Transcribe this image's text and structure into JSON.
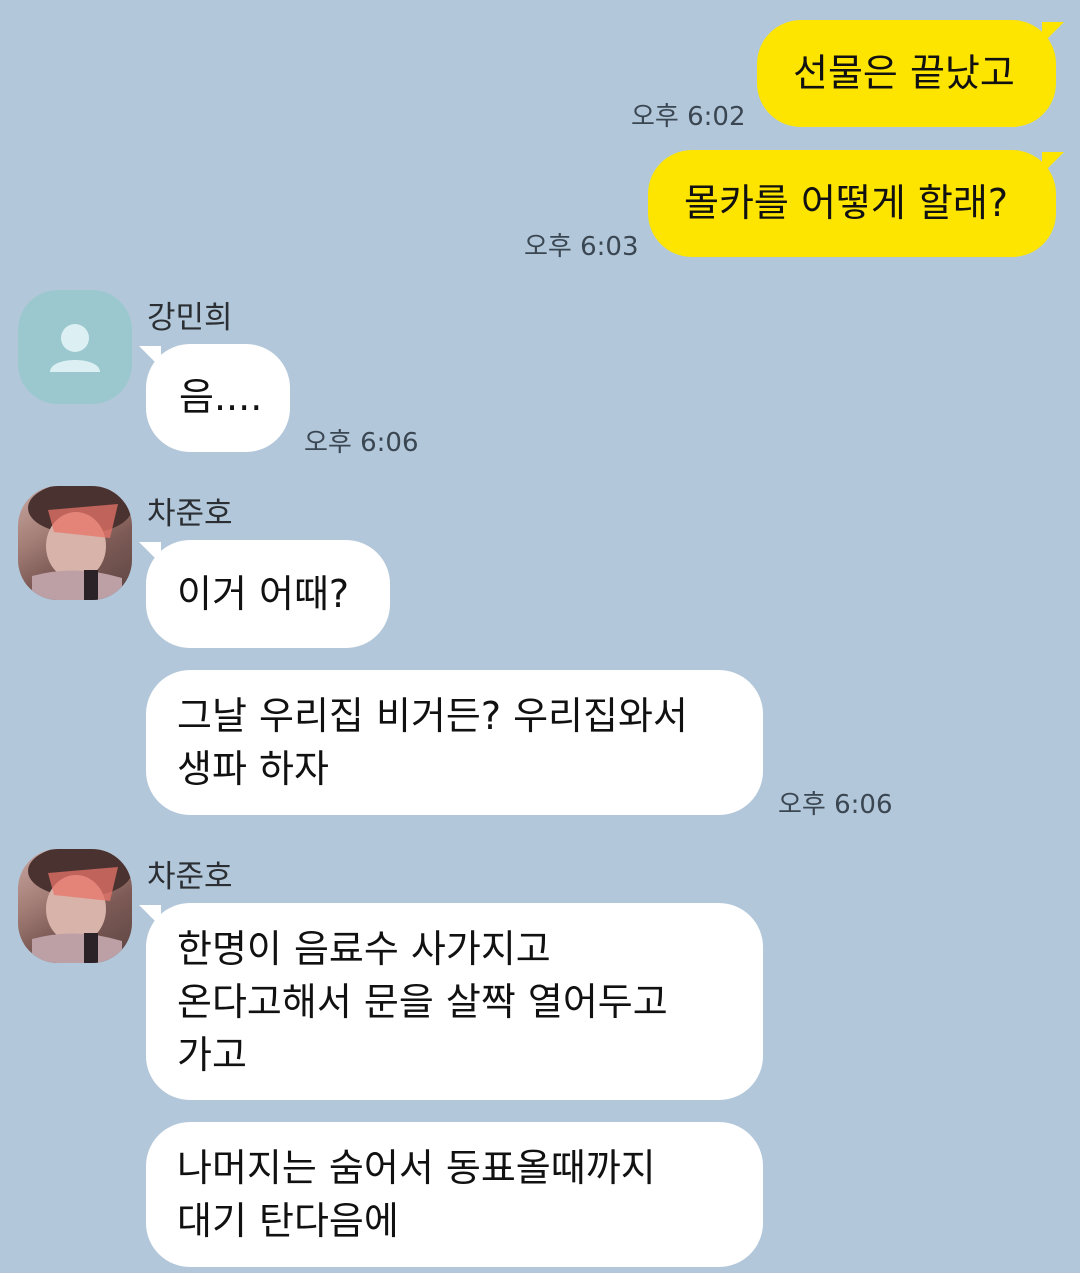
{
  "messages": {
    "m1": {
      "text": "선물은 끝났고",
      "time": "오후 6:02"
    },
    "m2": {
      "text": "몰카를 어떻게 할래?",
      "time": "오후 6:03"
    },
    "m3": {
      "sender": "강민희",
      "text": "음....",
      "time": "오후 6:06"
    },
    "m4": {
      "sender": "차준호",
      "text": "이거 어때?"
    },
    "m5": {
      "lines": [
        "그날 우리집 비거든? 우리집와서",
        "생파 하자"
      ],
      "time": "오후 6:06"
    },
    "m6": {
      "sender": "차준호",
      "lines": [
        "한명이 음료수 사가지고",
        "온다고해서 문을 살짝 열어두고",
        "가고"
      ]
    },
    "m7": {
      "lines": [
        "나머지는 숨어서 동표올때까지",
        "대기 탄다음에"
      ]
    }
  },
  "colors": {
    "background": "#b2c7d9",
    "outgoing_bubble": "#fee500",
    "incoming_bubble": "#ffffff",
    "default_avatar": "#9bc8cf"
  }
}
